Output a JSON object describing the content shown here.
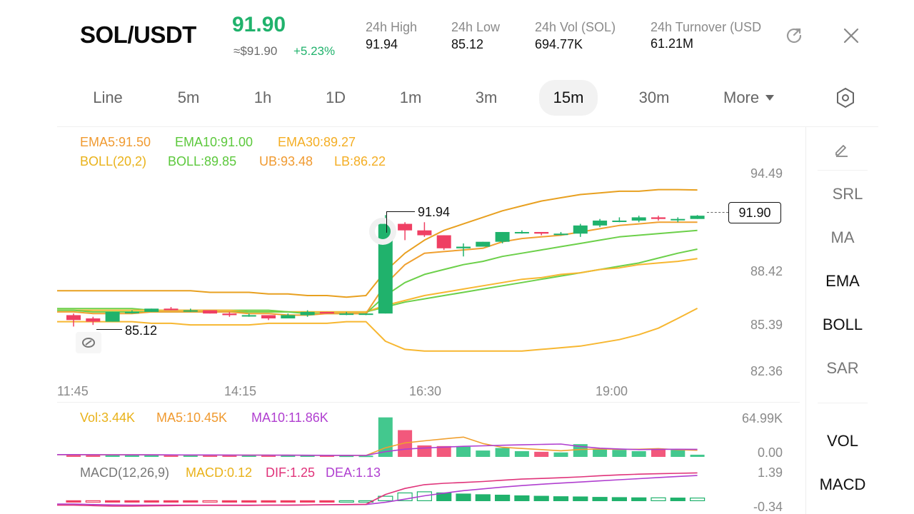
{
  "header": {
    "pair": "SOL/USDT",
    "price": "91.90",
    "approx": "≈$91.90",
    "change": "+5.23%",
    "stats": [
      {
        "label": "24h  High",
        "value": "91.94"
      },
      {
        "label": "24h  Low",
        "value": "85.12"
      },
      {
        "label": "24h  Vol (SOL)",
        "value": "694.77K"
      },
      {
        "label": "24h  Turnover (USD",
        "value": "61.21M"
      }
    ]
  },
  "intervals": [
    "Line",
    "5m",
    "1h",
    "1D",
    "1m",
    "3m",
    "15m",
    "30m",
    "More"
  ],
  "active_interval": "15m",
  "indicators": {
    "ema": {
      "ema5": "EMA5:91.50",
      "ema10": "EMA10:91.00",
      "ema30": "EMA30:89.27"
    },
    "boll": {
      "label": "BOLL(20,2)",
      "mid": "BOLL:89.85",
      "ub": "UB:93.48",
      "lb": "LB:86.22"
    },
    "vol": {
      "vol": "Vol:3.44K",
      "ma5": "MA5:10.45K",
      "ma10": "MA10:11.86K"
    },
    "macd": {
      "label": "MACD(12,26,9)",
      "macd": "MACD:0.12",
      "dif": "DIF:1.25",
      "dea": "DEA:1.13"
    }
  },
  "price_axis": [
    "94.49",
    "88.42",
    "85.39",
    "82.36"
  ],
  "time_axis": [
    "11:45",
    "14:15",
    "16:30",
    "19:00"
  ],
  "volume_axis": [
    "64.99K",
    "0.00"
  ],
  "macd_axis": [
    "1.39",
    "-0.34"
  ],
  "annotations": {
    "high": "91.94",
    "low": "85.12",
    "last": "91.90"
  },
  "sidebar": [
    "SRL",
    "MA",
    "EMA",
    "BOLL",
    "SAR",
    "VOL",
    "MACD"
  ],
  "sidebar_active": [
    "EMA",
    "BOLL",
    "VOL",
    "MACD"
  ],
  "colors": {
    "up": "#20b26c",
    "down": "#ef3f63",
    "ema5": "#f0a030",
    "ema10": "#6cd04a",
    "ema30": "#f7b731",
    "boll": "#e8a020",
    "purple": "#b03fd0"
  },
  "chart_data": {
    "type": "candlestick",
    "interval": "15m",
    "candles": [
      {
        "o": 85.8,
        "h": 85.9,
        "l": 85.1,
        "c": 85.5
      },
      {
        "o": 85.6,
        "h": 85.7,
        "l": 85.2,
        "c": 85.4
      },
      {
        "o": 85.4,
        "h": 86.0,
        "l": 85.4,
        "c": 86.0
      },
      {
        "o": 86.0,
        "h": 86.1,
        "l": 85.9,
        "c": 86.0
      },
      {
        "o": 86.0,
        "h": 86.2,
        "l": 86.0,
        "c": 86.2
      },
      {
        "o": 86.2,
        "h": 86.3,
        "l": 86.1,
        "c": 86.1
      },
      {
        "o": 86.1,
        "h": 86.2,
        "l": 86.0,
        "c": 86.1
      },
      {
        "o": 86.1,
        "h": 86.1,
        "l": 85.9,
        "c": 85.9
      },
      {
        "o": 85.9,
        "h": 86.0,
        "l": 85.7,
        "c": 85.8
      },
      {
        "o": 85.8,
        "h": 85.9,
        "l": 85.7,
        "c": 85.8
      },
      {
        "o": 85.8,
        "h": 85.8,
        "l": 85.5,
        "c": 85.6
      },
      {
        "o": 85.6,
        "h": 85.9,
        "l": 85.6,
        "c": 85.8
      },
      {
        "o": 85.8,
        "h": 86.1,
        "l": 85.7,
        "c": 86.0
      },
      {
        "o": 86.0,
        "h": 86.0,
        "l": 85.9,
        "c": 85.9
      },
      {
        "o": 85.9,
        "h": 86.0,
        "l": 85.8,
        "c": 85.9
      },
      {
        "o": 85.9,
        "h": 85.9,
        "l": 85.8,
        "c": 85.9
      },
      {
        "o": 85.9,
        "h": 91.94,
        "l": 85.9,
        "c": 91.4
      },
      {
        "o": 91.4,
        "h": 91.5,
        "l": 90.4,
        "c": 91.0
      },
      {
        "o": 91.0,
        "h": 91.5,
        "l": 90.6,
        "c": 90.7
      },
      {
        "o": 90.7,
        "h": 90.7,
        "l": 89.8,
        "c": 89.9
      },
      {
        "o": 89.9,
        "h": 90.2,
        "l": 89.4,
        "c": 90.0
      },
      {
        "o": 90.0,
        "h": 90.3,
        "l": 90.0,
        "c": 90.3
      },
      {
        "o": 90.3,
        "h": 90.9,
        "l": 90.2,
        "c": 90.9
      },
      {
        "o": 90.9,
        "h": 91.0,
        "l": 90.8,
        "c": 90.9
      },
      {
        "o": 90.9,
        "h": 90.9,
        "l": 90.7,
        "c": 90.8
      },
      {
        "o": 90.8,
        "h": 90.9,
        "l": 90.7,
        "c": 90.8
      },
      {
        "o": 90.8,
        "h": 91.4,
        "l": 90.6,
        "c": 91.3
      },
      {
        "o": 91.3,
        "h": 91.7,
        "l": 91.2,
        "c": 91.6
      },
      {
        "o": 91.6,
        "h": 91.8,
        "l": 91.5,
        "c": 91.6
      },
      {
        "o": 91.6,
        "h": 91.9,
        "l": 91.5,
        "c": 91.8
      },
      {
        "o": 91.8,
        "h": 91.9,
        "l": 91.6,
        "c": 91.7
      },
      {
        "o": 91.7,
        "h": 91.8,
        "l": 91.5,
        "c": 91.7
      },
      {
        "o": 91.7,
        "h": 91.94,
        "l": 91.7,
        "c": 91.9
      }
    ],
    "ema5": [
      86.0,
      85.9,
      85.9,
      85.9,
      86.0,
      86.0,
      86.0,
      86.0,
      86.0,
      85.9,
      85.9,
      85.8,
      85.8,
      85.9,
      85.9,
      85.9,
      87.7,
      88.9,
      89.6,
      89.7,
      89.8,
      89.9,
      90.3,
      90.5,
      90.6,
      90.7,
      90.9,
      91.1,
      91.3,
      91.4,
      91.5,
      91.5,
      91.5
    ],
    "ema10": [
      86.1,
      86.0,
      86.0,
      86.0,
      86.0,
      86.0,
      86.0,
      86.0,
      86.0,
      86.0,
      86.0,
      86.0,
      85.9,
      85.9,
      85.9,
      85.9,
      87.0,
      87.8,
      88.3,
      88.6,
      88.9,
      89.1,
      89.4,
      89.6,
      89.8,
      90.0,
      90.2,
      90.4,
      90.6,
      90.7,
      90.8,
      90.9,
      91.0
    ],
    "ema30": [
      86.1,
      86.1,
      86.1,
      86.1,
      86.1,
      86.1,
      86.1,
      86.1,
      86.1,
      86.0,
      86.0,
      86.0,
      86.0,
      86.0,
      86.0,
      86.0,
      86.4,
      86.7,
      87.0,
      87.2,
      87.4,
      87.6,
      87.8,
      88.0,
      88.1,
      88.3,
      88.4,
      88.6,
      88.7,
      88.9,
      89.0,
      89.1,
      89.27
    ],
    "boll_ub": [
      87.3,
      87.3,
      87.3,
      87.3,
      87.3,
      87.3,
      87.3,
      87.2,
      87.2,
      87.2,
      87.1,
      87.1,
      87.0,
      87.0,
      86.9,
      87.0,
      88.5,
      89.6,
      90.4,
      91.0,
      91.4,
      91.8,
      92.2,
      92.5,
      92.8,
      93.0,
      93.2,
      93.3,
      93.4,
      93.4,
      93.5,
      93.5,
      93.48
    ],
    "boll_mid": [
      86.2,
      86.2,
      86.2,
      86.2,
      86.1,
      86.1,
      86.1,
      86.1,
      86.1,
      86.1,
      86.1,
      86.0,
      86.0,
      86.0,
      86.0,
      86.0,
      86.3,
      86.6,
      86.8,
      87.0,
      87.2,
      87.4,
      87.6,
      87.8,
      88.0,
      88.2,
      88.4,
      88.6,
      88.8,
      89.0,
      89.3,
      89.6,
      89.85
    ],
    "boll_lb": [
      85.4,
      85.4,
      85.4,
      85.4,
      85.3,
      85.3,
      85.2,
      85.2,
      85.2,
      85.2,
      85.3,
      85.3,
      85.3,
      85.3,
      85.4,
      85.4,
      84.2,
      83.7,
      83.6,
      83.6,
      83.6,
      83.6,
      83.6,
      83.6,
      83.7,
      83.8,
      83.9,
      84.1,
      84.3,
      84.6,
      85.0,
      85.6,
      86.22
    ],
    "volume": [
      4.2,
      3.1,
      3.5,
      3.0,
      2.8,
      2.9,
      2.6,
      3.0,
      2.7,
      2.4,
      2.6,
      2.2,
      2.5,
      2.3,
      2.1,
      2.0,
      62.0,
      42.0,
      18.0,
      17.0,
      16.0,
      10.0,
      14.0,
      9.0,
      8.0,
      7.0,
      20.0,
      13.0,
      11.0,
      9.0,
      12.0,
      11.0,
      3.44
    ],
    "vol_ma5": [
      3.4,
      3.3,
      3.3,
      3.2,
      3.1,
      3.0,
      2.9,
      2.9,
      2.8,
      2.7,
      2.7,
      2.6,
      2.5,
      2.4,
      2.3,
      2.2,
      14.2,
      22.0,
      25.2,
      28.2,
      31.0,
      21.0,
      15.0,
      13.2,
      11.4,
      9.6,
      11.6,
      12.4,
      11.8,
      12.0,
      13.0,
      11.2,
      10.45
    ],
    "vol_ma10": [
      3.6,
      3.5,
      3.4,
      3.3,
      3.2,
      3.1,
      3.0,
      3.0,
      2.9,
      2.8,
      2.8,
      2.7,
      2.6,
      2.5,
      2.5,
      2.4,
      8.2,
      12.1,
      13.9,
      15.3,
      16.6,
      17.4,
      18.3,
      18.9,
      19.6,
      20.2,
      16.4,
      13.7,
      12.4,
      11.4,
      11.9,
      12.0,
      11.86
    ],
    "macd_hist": [
      -0.02,
      -0.03,
      -0.03,
      -0.02,
      -0.02,
      -0.01,
      -0.01,
      -0.02,
      -0.02,
      -0.02,
      -0.02,
      -0.01,
      -0.01,
      -0.01,
      0.0,
      0.0,
      0.2,
      0.35,
      0.4,
      0.35,
      0.3,
      0.27,
      0.25,
      0.22,
      0.2,
      0.18,
      0.17,
      0.15,
      0.14,
      0.13,
      0.13,
      0.12,
      0.12
    ],
    "macd_dif": [
      -0.2,
      -0.22,
      -0.24,
      -0.24,
      -0.23,
      -0.22,
      -0.21,
      -0.21,
      -0.21,
      -0.21,
      -0.2,
      -0.2,
      -0.19,
      -0.18,
      -0.17,
      -0.16,
      0.28,
      0.55,
      0.72,
      0.78,
      0.82,
      0.86,
      0.92,
      0.97,
      1.0,
      1.03,
      1.07,
      1.12,
      1.16,
      1.19,
      1.21,
      1.23,
      1.25
    ],
    "macd_dea": [
      -0.15,
      -0.17,
      -0.19,
      -0.2,
      -0.2,
      -0.2,
      -0.2,
      -0.2,
      -0.2,
      -0.2,
      -0.2,
      -0.2,
      -0.19,
      -0.18,
      -0.18,
      -0.17,
      -0.07,
      0.07,
      0.22,
      0.34,
      0.45,
      0.53,
      0.61,
      0.68,
      0.74,
      0.79,
      0.84,
      0.89,
      0.94,
      0.99,
      1.04,
      1.09,
      1.13
    ],
    "ylim_price": [
      82.36,
      94.49
    ],
    "ylim_volume": [
      0,
      64.99
    ],
    "ylim_macd": [
      -0.34,
      1.39
    ]
  }
}
